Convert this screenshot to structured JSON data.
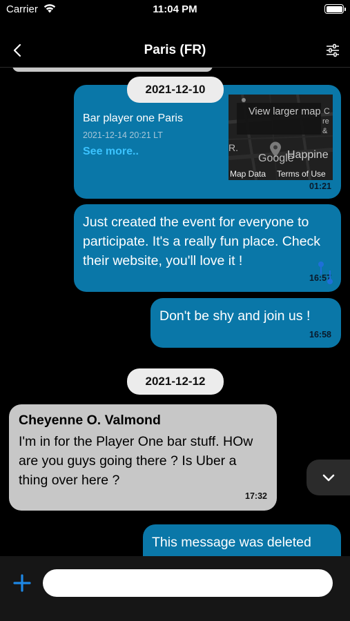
{
  "status_bar": {
    "carrier": "Carrier",
    "time": "11:04 PM",
    "battery_level": 1.0
  },
  "nav": {
    "title": "Paris (FR)",
    "back_icon": "chevron-left-icon",
    "filter_icon": "sliders-icon"
  },
  "colors": {
    "outgoing_bubble": "#0a77a8",
    "incoming_bubble": "#c7c7c7",
    "link": "#3bc3ff",
    "background": "#000000"
  },
  "chat": {
    "date_separators": [
      "2021-12-10",
      "2021-12-12"
    ],
    "location_message": {
      "title": "Bar player one Paris",
      "date": "2021-12-14 20:21 LT",
      "see_more": "See more..",
      "map": {
        "view_larger": "View larger map",
        "google": "Google",
        "overlay_word": "Happine",
        "map_data": "Map Data",
        "terms": "Terms of Use"
      },
      "time": "01:21"
    },
    "messages": [
      {
        "direction": "out",
        "text": "Just created the event for everyone to participate. It's a really fun place. Check their website, you'll love it !",
        "time": "16:57"
      },
      {
        "direction": "out",
        "text": "Don't be shy and join us !",
        "time": "16:58"
      },
      {
        "direction": "in",
        "sender": "Cheyenne O. Valmond",
        "text": "I'm in for the Player One bar stuff. HOw are you guys going there ? Is Uber a thing over here ?",
        "time": "17:32"
      },
      {
        "direction": "out",
        "text": "This message was deleted"
      }
    ]
  },
  "composer": {
    "plus_icon": "plus-icon",
    "input_value": "",
    "input_placeholder": ""
  }
}
